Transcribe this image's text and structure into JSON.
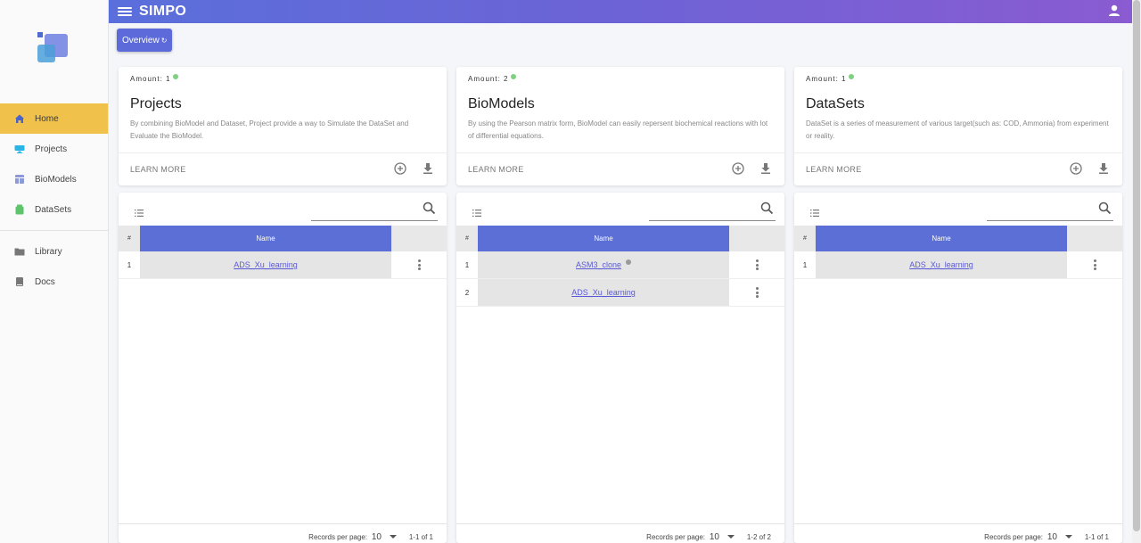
{
  "app": {
    "title": "SIMPO"
  },
  "colors": {
    "accent": "#5c6bd9",
    "active_nav": "#f1c24b",
    "header_start": "#5a6fdb",
    "header_end": "#8a5bd1"
  },
  "sidebar": {
    "items": [
      {
        "label": "Home",
        "icon": "home-icon",
        "active": true
      },
      {
        "label": "Projects",
        "icon": "projects-icon"
      },
      {
        "label": "BioModels",
        "icon": "biomodels-icon"
      },
      {
        "label": "DataSets",
        "icon": "datasets-icon"
      },
      {
        "label": "Library",
        "icon": "folder-icon"
      },
      {
        "label": "Docs",
        "icon": "book-icon"
      }
    ]
  },
  "toolbar": {
    "overview_label": "Overview",
    "overview_icon": "↻"
  },
  "cards": [
    {
      "amount_label": "Amount: 1",
      "title": "Projects",
      "description": "By combining BioModel and Dataset, Project provide a way to Simulate the DataSet and Evaluate the BioModel.",
      "learn_more": "LEARN MORE",
      "table": {
        "col_num": "#",
        "col_name": "Name",
        "rows": [
          {
            "num": "1",
            "name": "ADS_Xu_learning"
          }
        ],
        "footer": {
          "rpp_label": "Records per page:",
          "rpp_value": "10",
          "range": "1-1 of 1"
        }
      }
    },
    {
      "amount_label": "Amount: 2",
      "title": "BioModels",
      "description": "By using the Pearson matrix form, BioModel can easily repersent biochemical reactions with lot of differential equations.",
      "learn_more": "LEARN MORE",
      "table": {
        "col_num": "#",
        "col_name": "Name",
        "rows": [
          {
            "num": "1",
            "name": "ASM3_clone",
            "info": true
          },
          {
            "num": "2",
            "name": "ADS_Xu_learning"
          }
        ],
        "footer": {
          "rpp_label": "Records per page:",
          "rpp_value": "10",
          "range": "1-2 of 2"
        }
      }
    },
    {
      "amount_label": "Amount: 1",
      "title": "DataSets",
      "description": "DataSet is a series of measurement of various target(such as: COD, Ammonia) from experiment or reality.",
      "learn_more": "LEARN MORE",
      "table": {
        "col_num": "#",
        "col_name": "Name",
        "rows": [
          {
            "num": "1",
            "name": "ADS_Xu_learning"
          }
        ],
        "footer": {
          "rpp_label": "Records per page:",
          "rpp_value": "10",
          "range": "1-1 of 1"
        }
      }
    }
  ]
}
